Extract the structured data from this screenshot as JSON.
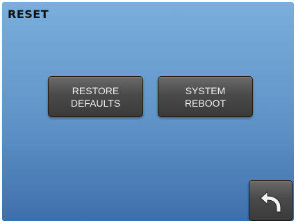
{
  "screen": {
    "title": "RESET"
  },
  "buttons": {
    "restore_defaults": {
      "line1": "RESTORE",
      "line2": "DEFAULTS"
    },
    "system_reboot": {
      "line1": "SYSTEM",
      "line2": "REBOOT"
    },
    "back": {
      "icon": "back-arrow-icon"
    }
  },
  "colors": {
    "background_top": "#7aaedb",
    "background_bottom": "#3f6fab",
    "button": "#4a4a4a",
    "button_text": "#f2f2f2",
    "title_text": "#111111"
  }
}
